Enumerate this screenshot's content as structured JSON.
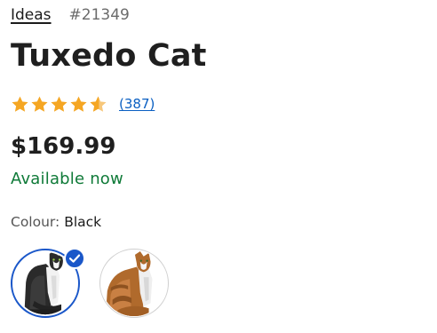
{
  "breadcrumb": {
    "theme_label": "Ideas",
    "set_number": "#21349"
  },
  "product": {
    "title": "Tuxedo Cat",
    "rating": {
      "value": 4.5,
      "max": 5,
      "count_label": "(387)"
    },
    "price": "$169.99",
    "availability": "Available now",
    "colour_label": "Colour:",
    "colour_value": "Black"
  },
  "swatches": [
    {
      "icon": "black-tuxedo-cat-thumbnail",
      "selected": true
    },
    {
      "icon": "orange-tabby-cat-thumbnail",
      "selected": false
    }
  ],
  "colors": {
    "star": "#f5a623",
    "link": "#0a5fc2",
    "availability": "#0f7a38",
    "selected_ring": "#1a57c9"
  }
}
